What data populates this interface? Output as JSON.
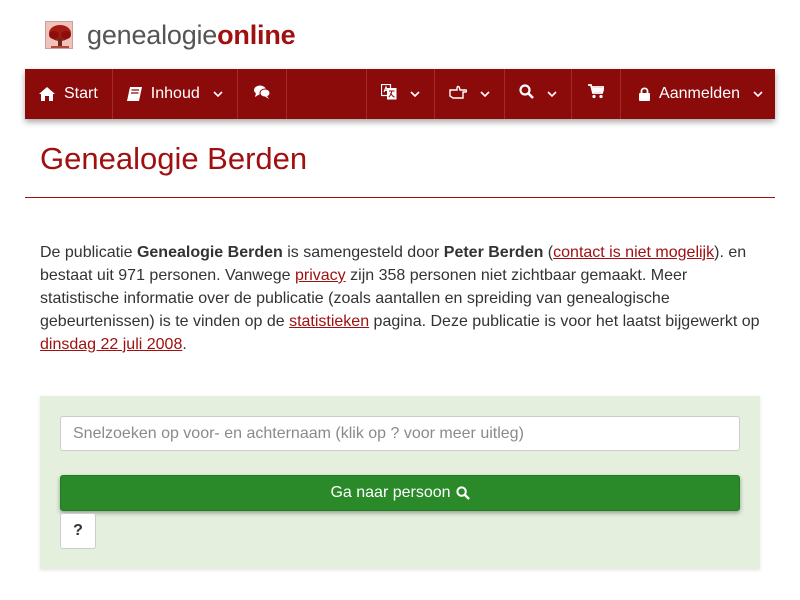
{
  "brand": {
    "part1": "genealogie",
    "part2": "online"
  },
  "nav": {
    "start_label": "Start",
    "content_label": "Inhoud",
    "login_label": "Aanmelden",
    "icons": [
      "home-icon",
      "book-icon",
      "comments-icon",
      "language-icon",
      "hand-point-icon",
      "search-icon",
      "cart-icon",
      "lock-icon"
    ]
  },
  "page": {
    "title": "Genealogie Berden"
  },
  "intro": {
    "t1": "De publicatie ",
    "pub_name": "Genealogie Berden",
    "t2": " is samengesteld door ",
    "author": "Peter Berden",
    "t3": " (",
    "contact_link": "contact is niet mogelijk",
    "t4": "). en bestaat uit 971 personen. Vanwege ",
    "privacy_link": "privacy",
    "t5": " zijn 358 personen niet zichtbaar gemaakt. Meer statistische informatie over de publicatie (zoals aantallen en spreiding van genealogische gebeurtenissen) is te vinden op de ",
    "stats_link": "statistieken",
    "t6": " pagina. Deze publicatie is voor het laatst bijgewerkt op ",
    "date_link": "dinsdag 22 juli 2008",
    "t7": "."
  },
  "search": {
    "placeholder": "Snelzoeken op voor- en achternaam (klik op ? voor meer uitleg)",
    "value": "",
    "button_label": "Ga naar persoon",
    "help_label": "?"
  },
  "colors": {
    "brand_red": "#8b0b0b",
    "title_red": "#a01010",
    "panel_green": "#e4efde",
    "button_green": "#2a8a2a"
  }
}
